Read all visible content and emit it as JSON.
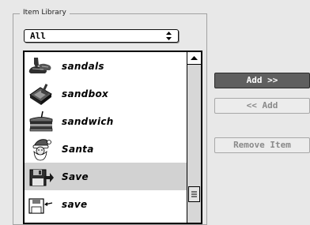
{
  "library": {
    "group_label": "Item Library",
    "category": {
      "selected": "All"
    },
    "items": [
      {
        "label": "sandals",
        "icon": "sandals-icon",
        "selected": false
      },
      {
        "label": "sandbox",
        "icon": "sandbox-icon",
        "selected": false
      },
      {
        "label": "sandwich",
        "icon": "sandwich-icon",
        "selected": false
      },
      {
        "label": "Santa",
        "icon": "santa-icon",
        "selected": false
      },
      {
        "label": "Save",
        "icon": "save-disk-icon",
        "selected": true
      },
      {
        "label": "save",
        "icon": "save-arrow-icon",
        "selected": false
      }
    ]
  },
  "actions": {
    "add_label": "Add >>",
    "remove_label": "<< Add",
    "remove_item_label": "Remove Item"
  },
  "colors": {
    "selection": "#d2d2d2",
    "primary_button": "#5f5f5f",
    "disabled_text": "#8a8a8a"
  }
}
